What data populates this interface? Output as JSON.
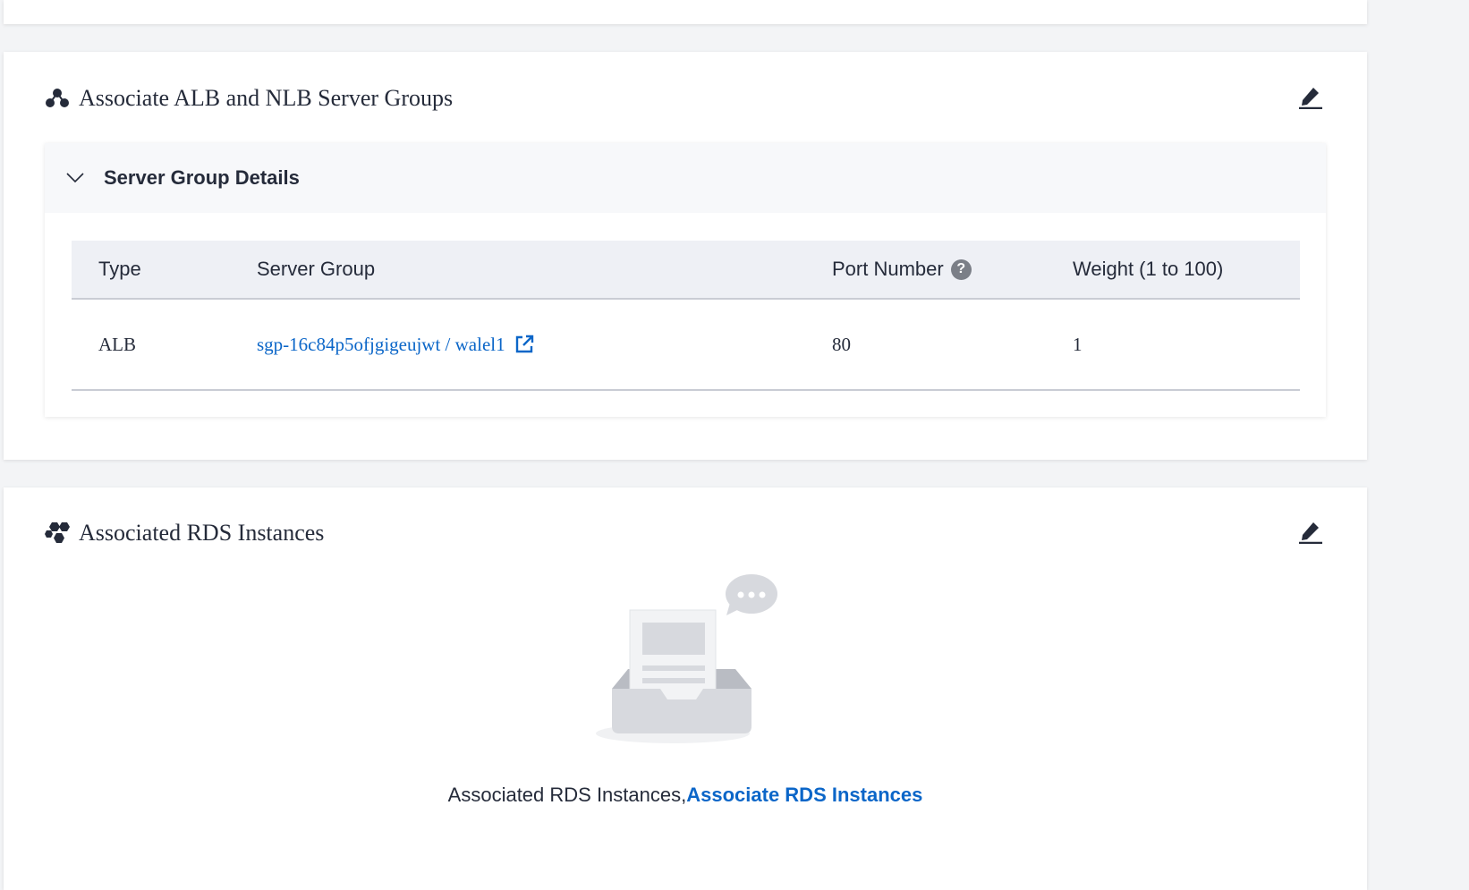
{
  "alb_section": {
    "title": "Associate ALB and NLB Server Groups",
    "panel": {
      "title": "Server Group Details",
      "columns": {
        "type": "Type",
        "server_group": "Server Group",
        "port_number": "Port Number",
        "weight": "Weight (1 to 100)"
      },
      "help_glyph": "?",
      "rows": [
        {
          "type": "ALB",
          "server_group": "sgp-16c84p5ofjgigeujwt / walel1",
          "port": "80",
          "weight": "1"
        }
      ]
    }
  },
  "rds_section": {
    "title": "Associated RDS Instances",
    "empty_text": "Associated RDS Instances,",
    "empty_link": "Associate RDS Instances"
  },
  "colors": {
    "link": "#0b66c8",
    "text": "#252b3a",
    "header_bg": "#eef0f5",
    "panel_bg": "#f7f8fa"
  },
  "icons": {
    "alb_header": "server-group-nodes-icon",
    "rds_header": "rds-cluster-icon",
    "edit": "pencil-edit-icon",
    "collapse": "chevron-down-icon",
    "help": "question-circle-icon",
    "external": "external-link-icon",
    "empty": "empty-inbox-illustration"
  }
}
